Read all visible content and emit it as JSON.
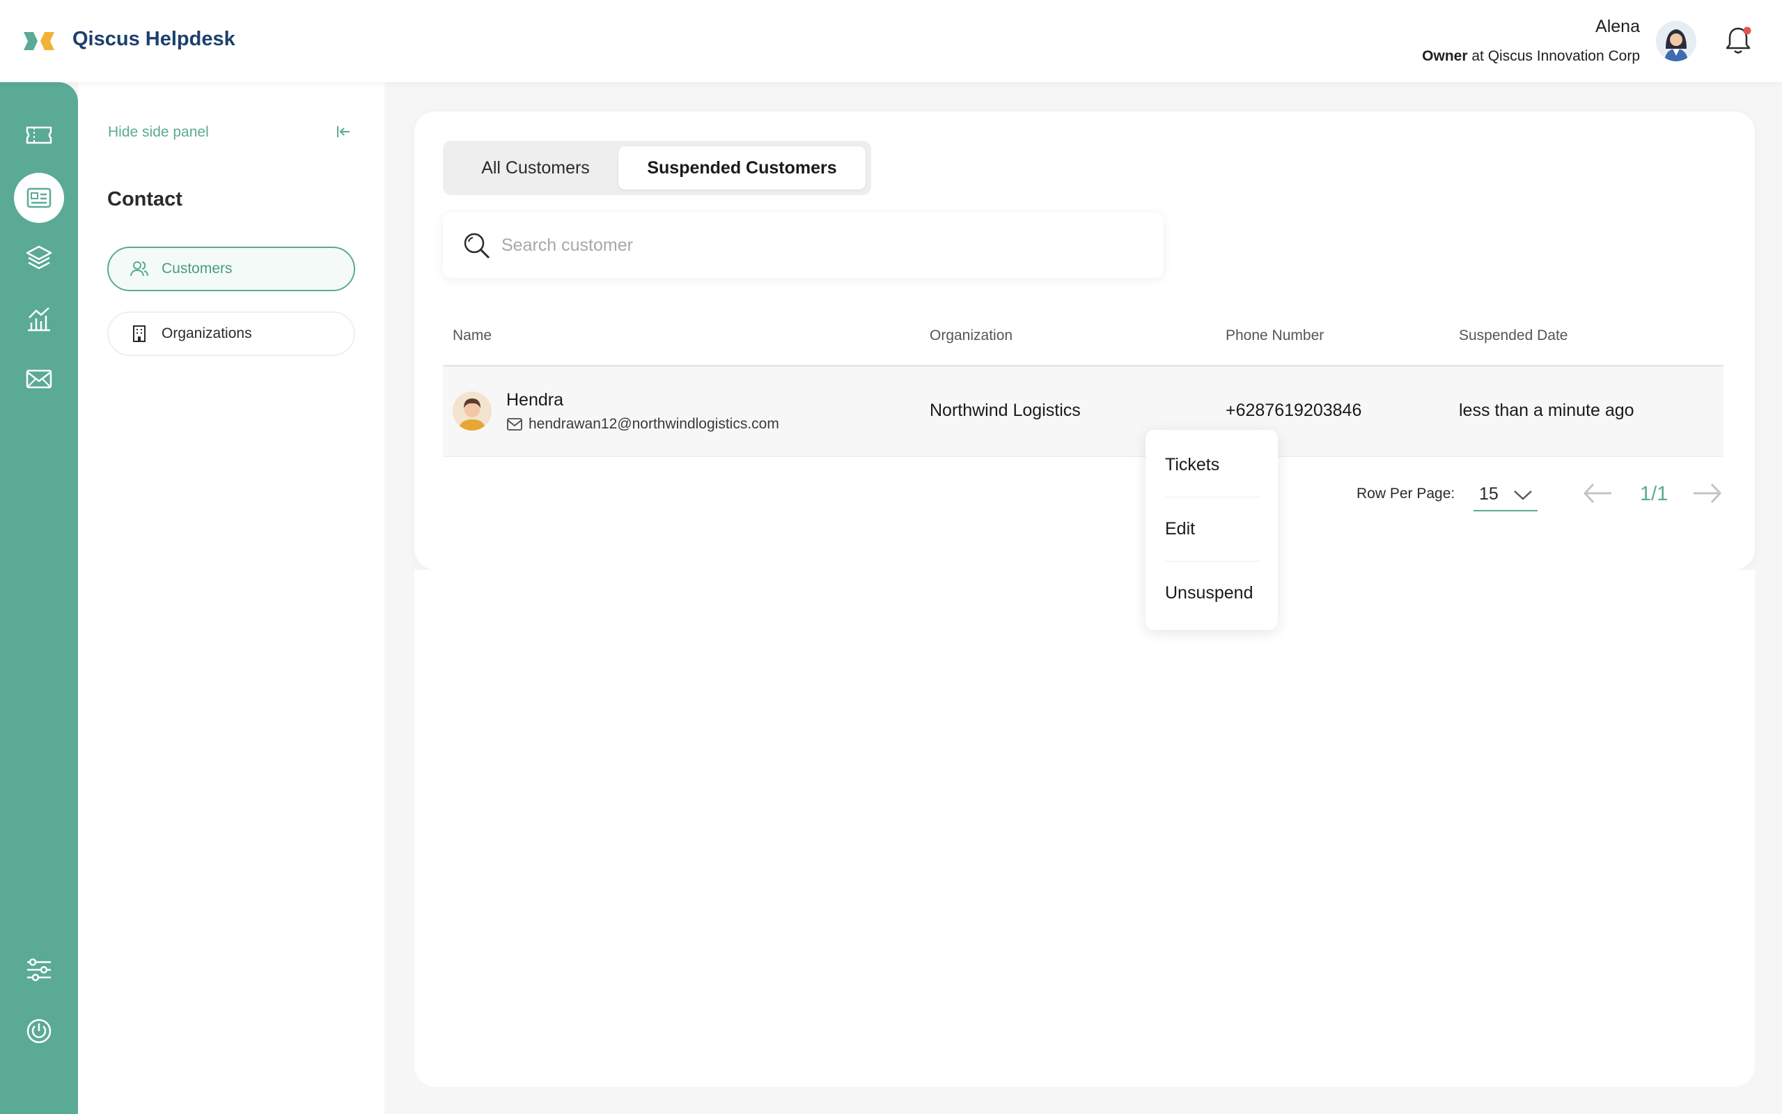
{
  "header": {
    "app_title": "Qiscus Helpdesk",
    "user_name": "Alena",
    "user_role": "Owner",
    "user_role_connector": "at",
    "user_company": "Qiscus Innovation Corp"
  },
  "sidebar_rail": {
    "accent_color": "#5aaa95",
    "items": [
      {
        "icon": "ticket-icon",
        "active": false
      },
      {
        "icon": "contact-card-icon",
        "active": true
      },
      {
        "icon": "layers-icon",
        "active": false
      },
      {
        "icon": "analytics-icon",
        "active": false
      },
      {
        "icon": "mail-icon",
        "active": false
      },
      {
        "icon": "settings-sliders-icon",
        "active": false
      },
      {
        "icon": "power-icon",
        "active": false
      }
    ]
  },
  "side_panel": {
    "hide_label": "Hide side panel",
    "section_title": "Contact",
    "items": [
      {
        "label": "Customers",
        "icon": "users-icon",
        "active": true
      },
      {
        "label": "Organizations",
        "icon": "building-icon",
        "active": false
      }
    ]
  },
  "main": {
    "tabs": [
      {
        "label": "All Customers",
        "active": false
      },
      {
        "label": "Suspended Customers",
        "active": true
      }
    ],
    "search": {
      "placeholder": "Search customer",
      "value": ""
    },
    "table": {
      "columns": [
        "Name",
        "Organization",
        "Phone Number",
        "Suspended Date"
      ],
      "rows": [
        {
          "name": "Hendra",
          "email": "hendrawan12@northwindlogistics.com",
          "organization": "Northwind Logistics",
          "phone": "+6287619203846",
          "suspended_date": "less than a minute ago"
        }
      ]
    },
    "pagination": {
      "rows_per_page_label": "Row Per Page:",
      "rows_per_page": "15",
      "page_indicator": "1/1"
    },
    "row_menu": {
      "items": [
        "Tickets",
        "Edit",
        "Unsuspend"
      ]
    }
  }
}
